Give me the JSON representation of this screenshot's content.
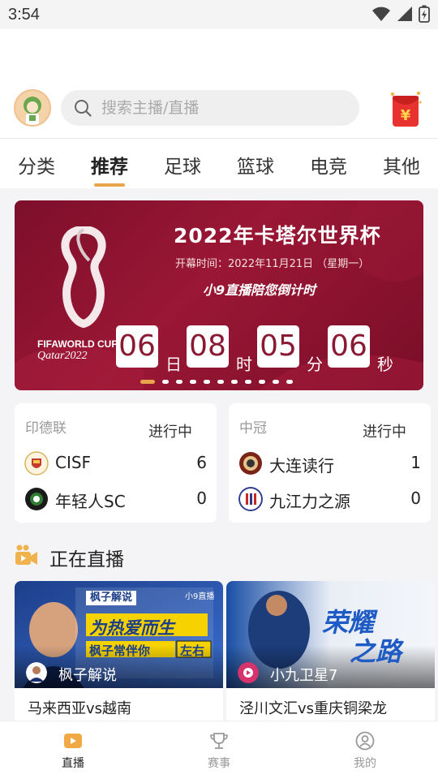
{
  "status_bar": {
    "time": "3:54"
  },
  "header": {
    "search_placeholder": "搜索主播/直播"
  },
  "tabs": [
    {
      "label": "分类",
      "active": false
    },
    {
      "label": "推荐",
      "active": true
    },
    {
      "label": "足球",
      "active": false
    },
    {
      "label": "篮球",
      "active": false
    },
    {
      "label": "电竞",
      "active": false
    },
    {
      "label": "其他",
      "active": false
    }
  ],
  "banner": {
    "title": "2022年卡塔尔世界杯",
    "subtitle": "开幕时间：2022年11月21日 （星期一）",
    "slogan": "小9直播陪您倒计时",
    "fifa_line1": "FIFAWORLD CUP",
    "fifa_line2": "Qatar2022",
    "countdown": {
      "days": "06",
      "days_unit": "日",
      "hours": "08",
      "hours_unit": "时",
      "minutes": "05",
      "minutes_unit": "分",
      "seconds": "06",
      "seconds_unit": "秒"
    },
    "slide_count": 11,
    "active_slide": 1
  },
  "matches": [
    {
      "league": "印德联",
      "status": "进行中",
      "home": {
        "name": "CISF",
        "score": "6"
      },
      "away": {
        "name": "年轻人SC",
        "score": "0"
      }
    },
    {
      "league": "中冠",
      "status": "进行中",
      "home": {
        "name": "大连读行",
        "score": "1"
      },
      "away": {
        "name": "九江力之源",
        "score": "0"
      }
    }
  ],
  "live_section": {
    "title": "正在直播",
    "items": [
      {
        "anchor": "枫子解说",
        "caption": "马来西亚vs越南",
        "thumb_tag": "枫子解说",
        "thumb_line1": "为热爱而生",
        "thumb_line2": "枫子常伴你",
        "thumb_badge": "左右",
        "thumb_brand": "小9直播"
      },
      {
        "anchor": "小九卫星7",
        "caption": "泾川文汇vs重庆铜梁龙",
        "thumb_line1": "荣耀",
        "thumb_line2": "之路"
      }
    ]
  },
  "bottom_nav": [
    {
      "label": "直播",
      "active": true
    },
    {
      "label": "赛事",
      "active": false
    },
    {
      "label": "我的",
      "active": false
    }
  ],
  "colors": {
    "accent": "#e8a54b",
    "banner_bg": "#8f1431",
    "countdown_text": "#8a1a33"
  }
}
